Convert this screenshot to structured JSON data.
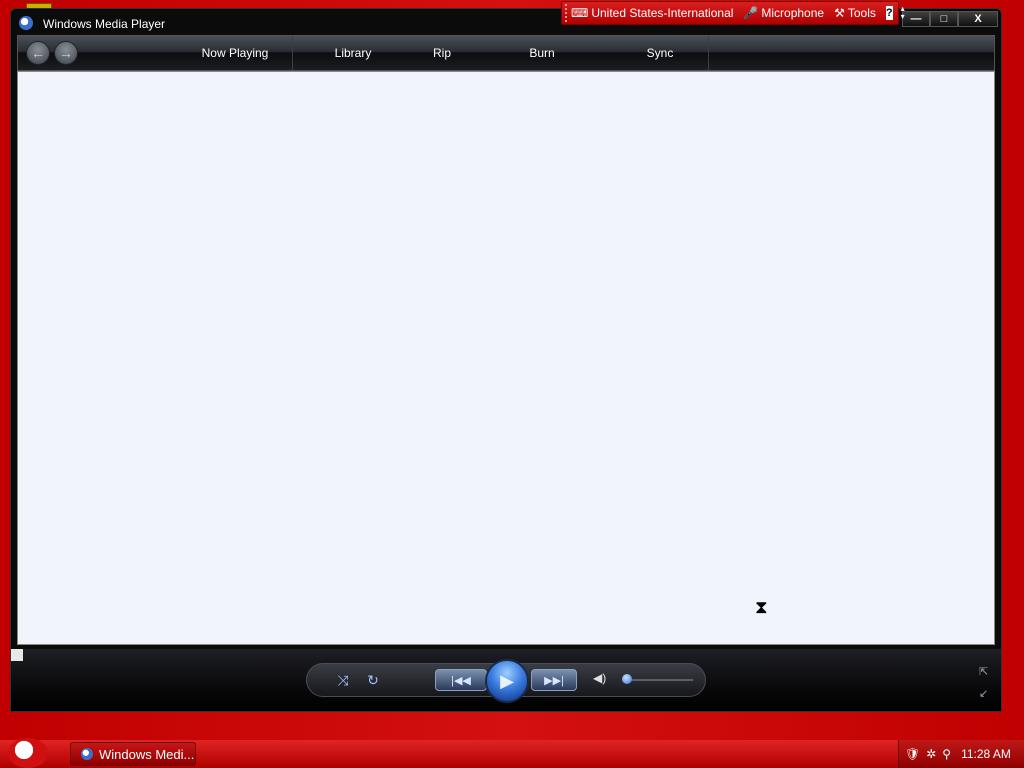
{
  "window": {
    "title": "Windows Media Player",
    "minimize": "—",
    "maximize": "□",
    "close": "X"
  },
  "language_bar": {
    "keyboard_icon": "keyboard-icon",
    "language": "United States-International",
    "microphone_icon": "microphone-icon",
    "microphone": "Microphone",
    "tools_icon": "tools-icon",
    "tools": "Tools",
    "help": "?",
    "arrow_up": "▴",
    "arrow_down": "▾"
  },
  "nav": {
    "back": "←",
    "forward": "→",
    "tabs": [
      {
        "label": "Now Playing"
      },
      {
        "label": "Library"
      },
      {
        "label": "Rip"
      },
      {
        "label": "Burn"
      },
      {
        "label": "Sync"
      }
    ]
  },
  "controls": {
    "shuffle": "⤨",
    "repeat": "↻",
    "prev": "|◀◀",
    "play": "▶",
    "next": "▶▶|",
    "mute": "◀)",
    "volume_level": 0.05,
    "switch_view": "⇱",
    "compact": "↙"
  },
  "taskbar": {
    "task_label": "Windows Medi...",
    "clock": "11:28 AM",
    "tray_icons": [
      "shield-icon",
      "network-icon",
      "search-icon"
    ]
  },
  "colors": {
    "desktop": "#c00000",
    "window_chrome": "#0b0b0b",
    "content_bg": "#f1f4fb",
    "accent_blue": "#3a7ce0"
  }
}
